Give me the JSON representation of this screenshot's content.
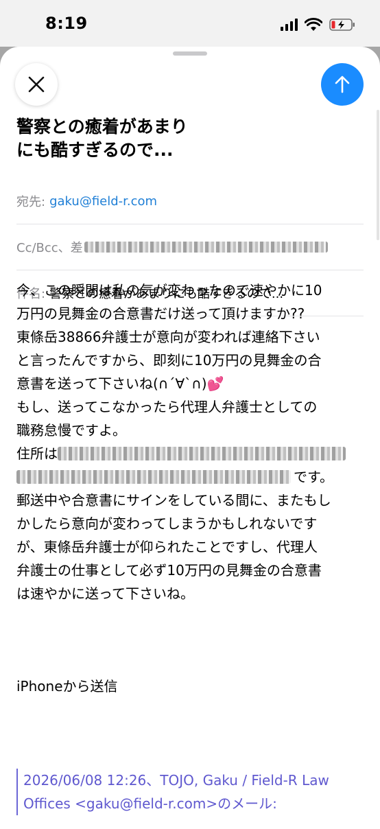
{
  "status_bar": {
    "time": "8:19"
  },
  "toolbar": {
    "close_icon": "close-icon",
    "send_icon": "arrow-up-icon",
    "send_color": "#1a8cff"
  },
  "draft": {
    "title_line1": "警察との癒着があまり",
    "title_line2": "にも酷すぎるので..."
  },
  "fields": {
    "to_label": "宛先:",
    "to_value": "gaku@field-r.com",
    "cc_label": "Cc/Bcc、差",
    "subject_label": "件名:",
    "subject_value": "警察との癒着があまりにも酷すぎるので..."
  },
  "body": {
    "lines": [
      "今、この瞬間は私の気が変わったので速やかに10",
      "万円の見舞金の合意書だけ送って頂けますか??",
      "東條岳38866弁護士が意向が変われば連絡下さい",
      "と言ったんですから、即刻に10万円の見舞金の合",
      "意書を送って下さいね(∩´∀`∩)💕",
      "もし、送ってこなかったら代理人弁護士としての",
      "職務怠慢ですよ。"
    ],
    "address_label": "住所は",
    "address_suffix": "です。",
    "lines_after": [
      "郵送中や合意書にサインをしている間に、またもし",
      "かしたら意向が変わってしまうかもしれないです",
      "が、東條岳弁護士が仰られたことですし、代理人",
      "弁護士の仕事として必ず10万円の見舞金の合意書",
      "は速やかに送って下さいね。"
    ]
  },
  "signature": "iPhoneから送信",
  "quote": {
    "line1": "2026/06/08 12:26、TOJO, Gaku / Field-R Law",
    "line2": "Offices <gaku@field-r.com>のメール:"
  }
}
